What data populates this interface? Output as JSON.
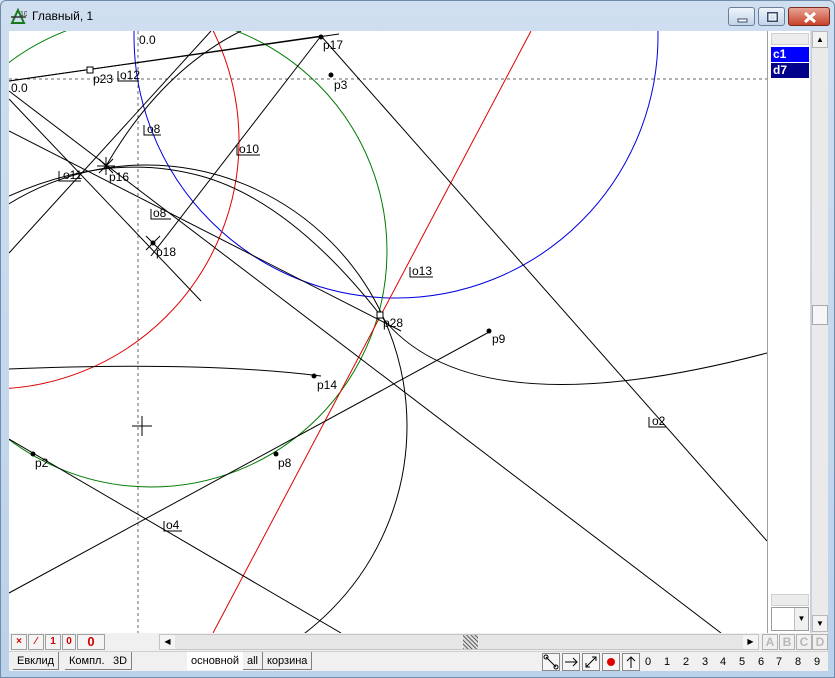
{
  "window": {
    "title": "Главный, 1",
    "icon": "geometry-app-icon"
  },
  "canvas": {
    "origin_label_top": "0.0",
    "origin_label_left": "0.0",
    "labels": {
      "p17": "p17",
      "p3": "p3",
      "p23": "p23",
      "o12": "o12",
      "o8a": "o8",
      "o10": "o10",
      "o11": "o11",
      "p16": "p16",
      "o8b": "o8",
      "p18": "p18",
      "o13": "o13",
      "p28": "p28",
      "p9": "p9",
      "p14": "p14",
      "o2": "o2",
      "p2": "p2",
      "p8": "p8",
      "o4": "o4"
    },
    "colors": {
      "red": "#e00000",
      "blue": "#0000e0",
      "green": "#007a00",
      "black": "#000000"
    }
  },
  "side_panel": {
    "items": [
      {
        "label": "c1",
        "color": "#0000ff"
      },
      {
        "label": "d7",
        "color": "#00008b"
      }
    ]
  },
  "bottom": {
    "mode_buttons": [
      "×",
      "⁄",
      "1",
      "0",
      "0"
    ],
    "abcd": [
      "A",
      "B",
      "C",
      "D"
    ]
  },
  "tabs": {
    "left": [
      "Евклид",
      "Компл.",
      "3D"
    ],
    "right": [
      "основной",
      "all",
      "корзина"
    ],
    "active": "основной",
    "digits": [
      "0",
      "1",
      "2",
      "3",
      "4",
      "5",
      "6",
      "7",
      "8",
      "9"
    ]
  }
}
